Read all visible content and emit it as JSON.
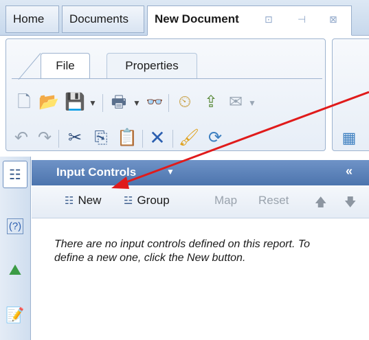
{
  "tabs": {
    "home": "Home",
    "documents": "Documents",
    "active": "New Document"
  },
  "ribbon": {
    "file": "File",
    "properties": "Properties"
  },
  "input_controls": {
    "title": "Input Controls",
    "collapse": "«",
    "caret": "▼",
    "new_label": "New",
    "group_label": "Group",
    "map_label": "Map",
    "reset_label": "Reset",
    "empty_message": "There are no input controls defined on this report. To define a new one, click the New button."
  },
  "sidebar": {
    "help_label": "(?)"
  },
  "colors": {
    "accent": "#4c74ad",
    "annotation_arrow": "#e01b1b"
  }
}
